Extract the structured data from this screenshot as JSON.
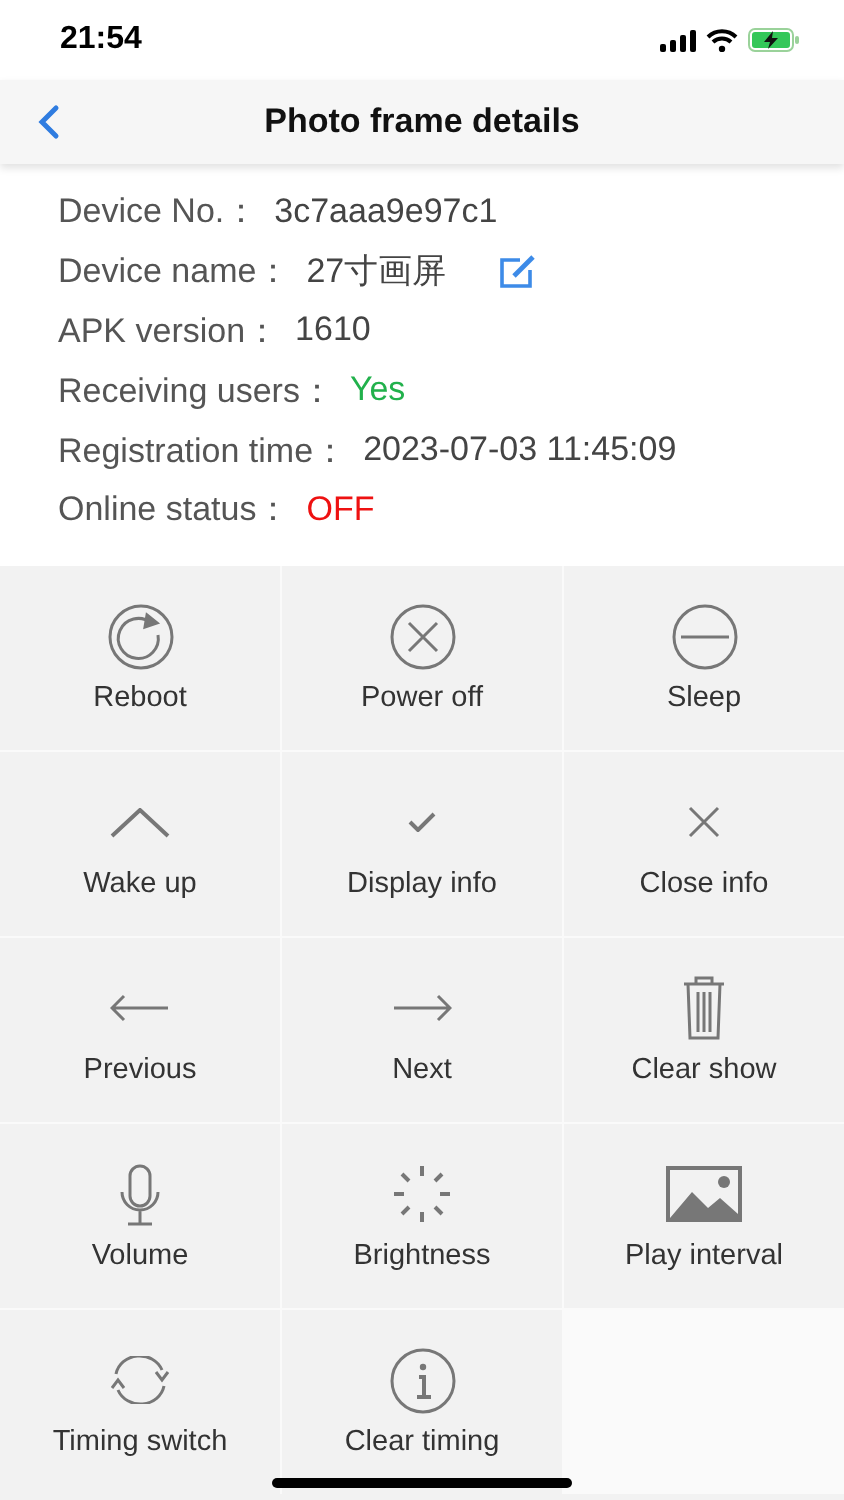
{
  "status_bar": {
    "time": "21:54"
  },
  "nav": {
    "title": "Photo frame details"
  },
  "info": [
    {
      "label": "Device No.：",
      "value": "3c7aaa9e97c1"
    },
    {
      "label": "Device name：",
      "value": "27寸画屏",
      "editable": true
    },
    {
      "label": "APK version：",
      "value": "1610"
    },
    {
      "label": "Receiving users：",
      "value": "Yes",
      "color": "#22b14c"
    },
    {
      "label": "Registration time：",
      "value": "2023-07-03 11:45:09"
    },
    {
      "label": "Online status：",
      "value": "OFF",
      "color": "#ee1111"
    }
  ],
  "actions": [
    {
      "label": "Reboot"
    },
    {
      "label": "Power off"
    },
    {
      "label": "Sleep"
    },
    {
      "label": "Wake up"
    },
    {
      "label": "Display info"
    },
    {
      "label": "Close info"
    },
    {
      "label": "Previous"
    },
    {
      "label": "Next"
    },
    {
      "label": "Clear show"
    },
    {
      "label": "Volume"
    },
    {
      "label": "Brightness"
    },
    {
      "label": "Play interval"
    },
    {
      "label": "Timing switch"
    },
    {
      "label": "Clear timing"
    }
  ]
}
